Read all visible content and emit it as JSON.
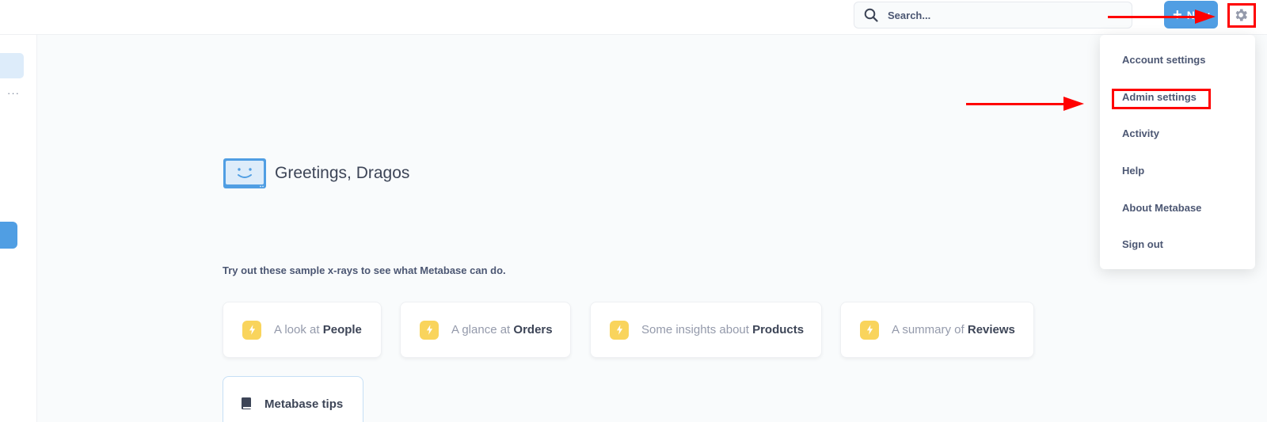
{
  "header": {
    "search_placeholder": "Search...",
    "new_button": "New",
    "new_button_icon": "plus-icon",
    "settings_icon": "gear-icon"
  },
  "sidebar": {
    "more_label": "···"
  },
  "greeting": {
    "icon": "smiling-monitor-icon",
    "text": "Greetings, Dragos"
  },
  "xrays": {
    "prompt": "Try out these sample x-rays to see what Metabase can do.",
    "cards": [
      {
        "prefix": "A look at ",
        "name": "People",
        "icon": "bolt-icon"
      },
      {
        "prefix": "A glance at ",
        "name": "Orders",
        "icon": "bolt-icon"
      },
      {
        "prefix": "Some insights about ",
        "name": "Products",
        "icon": "bolt-icon"
      },
      {
        "prefix": "A summary of ",
        "name": "Reviews",
        "icon": "bolt-icon"
      }
    ]
  },
  "tips": {
    "label": "Metabase tips",
    "icon": "book-icon"
  },
  "settings_menu": {
    "items": [
      "Account settings",
      "Admin settings",
      "Activity",
      "Help",
      "About Metabase",
      "Sign out"
    ]
  },
  "colors": {
    "brand": "#509ee3",
    "annotation": "#ff0000",
    "bolt": "#f9d45c"
  }
}
